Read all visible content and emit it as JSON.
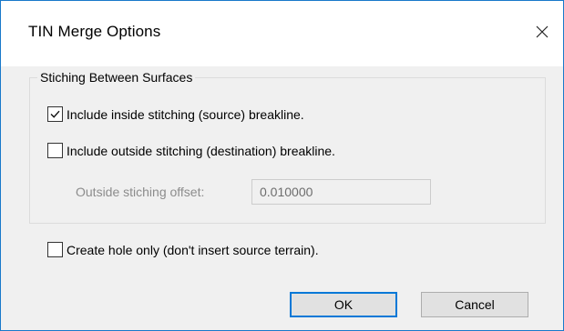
{
  "window": {
    "title": "TIN Merge Options",
    "close_icon": "close-icon"
  },
  "group": {
    "legend": "Stiching Between Surfaces",
    "inside": {
      "label": "Include inside stitching (source) breakline.",
      "checked": true
    },
    "outside": {
      "label": "Include outside stitching (destination) breakline.",
      "checked": false
    },
    "offset": {
      "label": "Outside stiching offset:",
      "value": "0.010000",
      "enabled": false
    }
  },
  "hole": {
    "label": "Create hole only (don't insert source terrain).",
    "checked": false
  },
  "buttons": {
    "ok_label": "OK",
    "cancel_label": "Cancel"
  },
  "colors": {
    "accent": "#0078d7",
    "border": "#1979ca",
    "disabled_text": "#8c8c8c"
  }
}
